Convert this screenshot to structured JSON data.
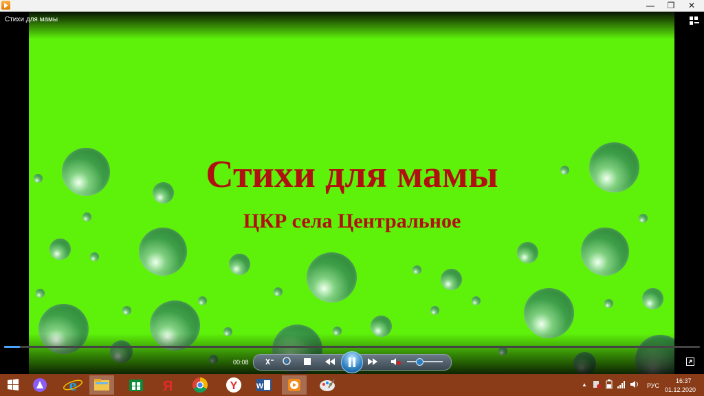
{
  "window": {
    "app_icon": "media-player-icon",
    "buttons": {
      "minimize": "—",
      "maximize": "❐",
      "close": "✕"
    }
  },
  "video": {
    "title": "Стихи для мамы",
    "headline": "Стихи для мамы",
    "subline": "ЦКР села Центральное",
    "background_color": "#5ef20a",
    "headline_color": "#b01010"
  },
  "controls": {
    "time": "00:08",
    "progress_percent": 2.3,
    "volume_percent": 35,
    "muted": true,
    "icons": [
      "shuffle-icon",
      "repeat-icon",
      "stop-icon",
      "rewind-icon",
      "pause-icon",
      "fast-forward-icon",
      "mute-icon",
      "fullscreen-icon"
    ]
  },
  "taskbar": {
    "apps": [
      "start-icon",
      "alice-icon",
      "ie-icon",
      "explorer-icon",
      "store-icon",
      "yandex-icon",
      "chrome-icon",
      "yandex-browser-icon",
      "word-icon",
      "media-player-icon",
      "paint-icon"
    ],
    "language": "РУС",
    "time": "16:37",
    "date": "01.12.2020"
  }
}
